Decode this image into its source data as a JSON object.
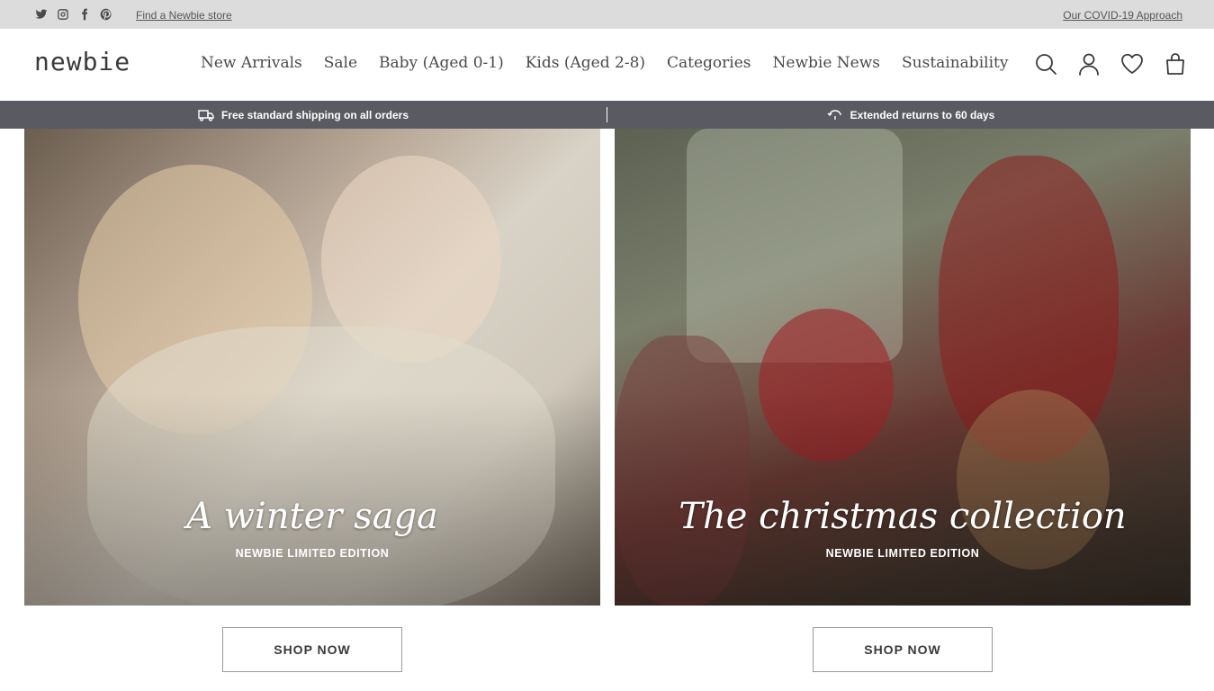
{
  "topbar": {
    "social_icons": [
      "twitter-icon",
      "instagram-icon",
      "facebook-icon",
      "pinterest-icon"
    ],
    "store_link": "Find a Newbie store",
    "covid_link": "Our COVID-19 Approach"
  },
  "header": {
    "logo": "newbie",
    "nav": [
      "New Arrivals",
      "Sale",
      "Baby (Aged 0-1)",
      "Kids (Aged 2-8)",
      "Categories",
      "Newbie News",
      "Sustainability"
    ],
    "icons": [
      "search-icon",
      "account-icon",
      "wishlist-icon",
      "bag-icon"
    ]
  },
  "announcement": {
    "left": "Free standard shipping on all orders",
    "right": "Extended returns to 60 days",
    "left_icon": "truck-icon",
    "right_icon": "return-icon"
  },
  "promos": [
    {
      "title": "A winter saga",
      "subtitle": "NEWBIE LIMITED EDITION",
      "button": "SHOP NOW"
    },
    {
      "title": "The christmas collection",
      "subtitle": "NEWBIE LIMITED EDITION",
      "button": "SHOP NOW"
    }
  ],
  "colors": {
    "topbar_bg": "#dcdcdc",
    "announcement_bg": "#5a5a62",
    "text": "#3a3a3a"
  }
}
